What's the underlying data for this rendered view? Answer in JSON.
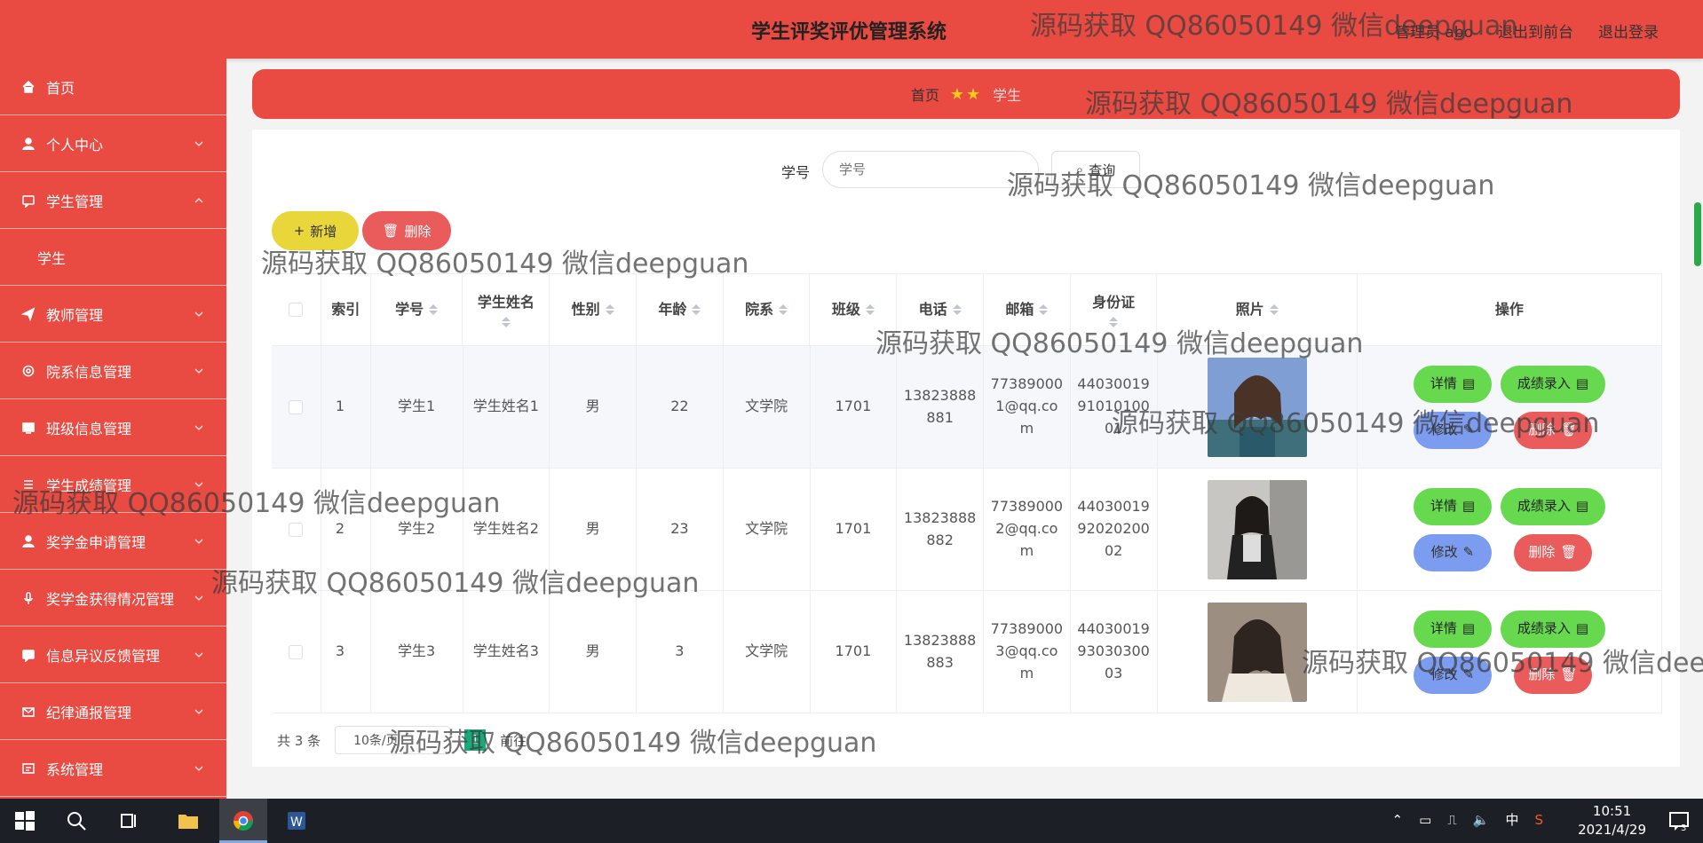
{
  "header": {
    "title": "学生评奖评优管理系统",
    "user_label": "管理员 abo",
    "frontend_link": "退出到前台",
    "logout_link": "退出登录"
  },
  "sidebar": {
    "items": [
      {
        "label": "首页",
        "icon": "home-icon"
      },
      {
        "label": "个人中心",
        "icon": "user-icon"
      },
      {
        "label": "学生管理",
        "icon": "chat-icon",
        "expanded": true
      },
      {
        "label": "学生",
        "icon": ""
      },
      {
        "label": "教师管理",
        "icon": "send-icon"
      },
      {
        "label": "院系信息管理",
        "icon": "settings-icon"
      },
      {
        "label": "班级信息管理",
        "icon": "monitor-icon"
      },
      {
        "label": "学生成绩管理",
        "icon": "list-icon"
      },
      {
        "label": "奖学金申请管理",
        "icon": "person-icon"
      },
      {
        "label": "奖学金获得情况管理",
        "icon": "microphone-icon"
      },
      {
        "label": "信息异议反馈管理",
        "icon": "message-icon"
      },
      {
        "label": "纪律通报管理",
        "icon": "mail-icon"
      },
      {
        "label": "系统管理",
        "icon": "system-icon"
      }
    ]
  },
  "breadcrumb": {
    "home": "首页",
    "current": "学生"
  },
  "search": {
    "label": "学号",
    "placeholder": "学号",
    "button": "查询"
  },
  "toolbar": {
    "add": "新增",
    "delete": "删除"
  },
  "table": {
    "headers": [
      "索引",
      "学号",
      "学生姓名",
      "性别",
      "年龄",
      "院系",
      "班级",
      "电话",
      "邮箱",
      "身份证",
      "照片",
      "操作"
    ],
    "rows": [
      {
        "index": "1",
        "student_no": "学生1",
        "name": "学生姓名1",
        "gender": "男",
        "age": "22",
        "department": "文学院",
        "class": "1701",
        "phone": "13823888881",
        "email": "773890001@qq.com",
        "id_card": "440300199101010001"
      },
      {
        "index": "2",
        "student_no": "学生2",
        "name": "学生姓名2",
        "gender": "男",
        "age": "23",
        "department": "文学院",
        "class": "1701",
        "phone": "13823888882",
        "email": "773890002@qq.com",
        "id_card": "440300199202020002"
      },
      {
        "index": "3",
        "student_no": "学生3",
        "name": "学生姓名3",
        "gender": "男",
        "age": "3",
        "department": "文学院",
        "class": "1701",
        "phone": "13823888883",
        "email": "773890003@qq.com",
        "id_card": "440300199303030003"
      }
    ],
    "actions": {
      "detail": "详情",
      "grade_entry": "成绩录入",
      "edit": "修改",
      "delete": "删除"
    }
  },
  "pagination": {
    "total": "共 3 条",
    "page_size": "10条/页",
    "current_page": "1",
    "goto_label": "前往"
  },
  "watermark": "源码获取 QQ86050149 微信deepguan",
  "taskbar": {
    "ime": "中",
    "time": "10:51",
    "date": "2021/4/29"
  },
  "colors": {
    "primary_red": "#e94a41",
    "add_yellow": "#e8d63a",
    "danger_red": "#ea5b5b",
    "success_green": "#67d94e",
    "edit_blue": "#7c9cf0"
  }
}
